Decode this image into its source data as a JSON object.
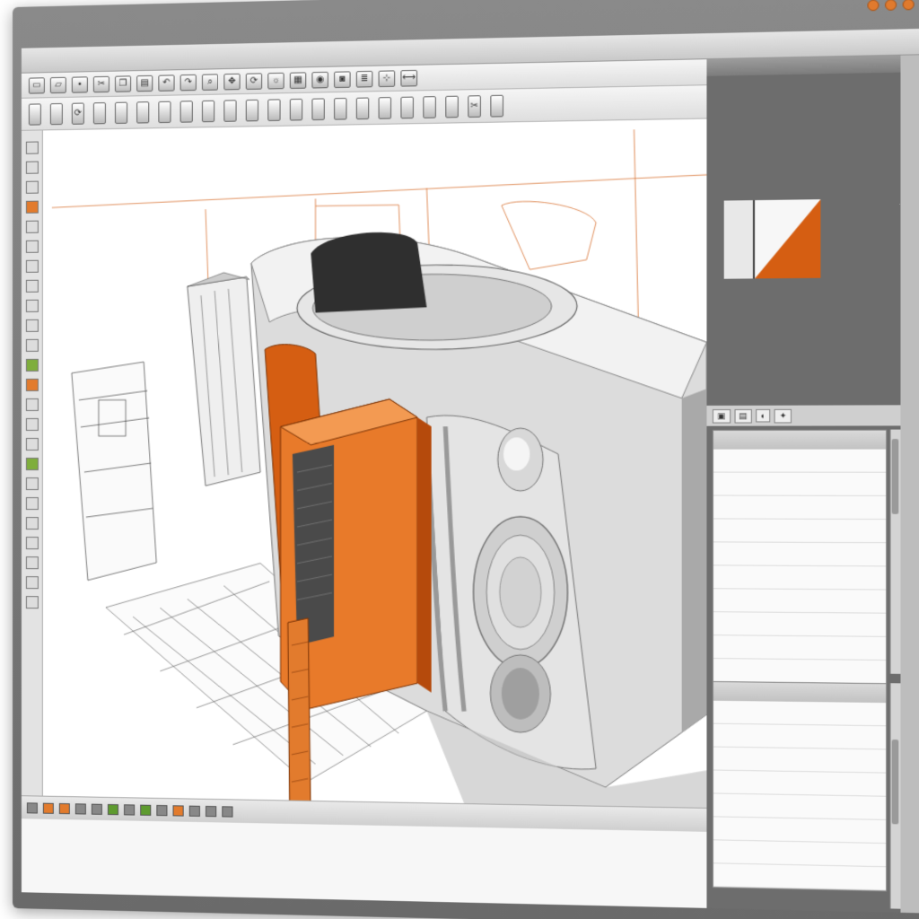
{
  "window": {
    "title": "",
    "title_right": ""
  },
  "colors": {
    "accent": "#e07a2e",
    "panel_bg": "#6d6d6d",
    "viewport_bg": "#ffffff",
    "model_orange": "#d55e12"
  },
  "toolbar_top": {
    "icons": [
      "doc-icon",
      "folder-icon",
      "save-icon",
      "cut-icon",
      "copy-icon",
      "paste-icon",
      "undo-icon",
      "redo-icon",
      "zoom-icon",
      "pan-icon",
      "rotate-icon",
      "light-icon",
      "grid-icon",
      "render-icon",
      "camera-icon",
      "layer-icon",
      "snap-icon",
      "measure-icon"
    ]
  },
  "toolbar_tools": {
    "icons": [
      "select-icon",
      "move-icon",
      "rotate-icon",
      "scale-icon",
      "extrude-icon",
      "cylinder-icon",
      "box-icon",
      "sphere-icon",
      "plane-icon",
      "line-icon",
      "arc-icon",
      "curve-icon",
      "text-icon",
      "dim-icon",
      "section-icon",
      "mirror-icon",
      "array-icon",
      "fillet-icon",
      "chamfer-icon",
      "shell-icon",
      "cut-icon",
      "boolean-icon"
    ]
  },
  "viewport": {
    "title": "",
    "label_lines": [
      "",
      ""
    ]
  },
  "right_panel": {
    "header": "",
    "subheader": "",
    "props_line_1": "",
    "props_line_2": "",
    "props_line_3": "",
    "props_line_4": "",
    "props_line_5": "",
    "material_header": "",
    "tree_header": "",
    "tree_items": [
      "",
      "",
      "",
      "",
      "",
      "",
      "",
      "",
      "",
      ""
    ],
    "tree2_header": "",
    "tree2_items": [
      "",
      "",
      "",
      "",
      "",
      "",
      "",
      ""
    ]
  },
  "status": {}
}
